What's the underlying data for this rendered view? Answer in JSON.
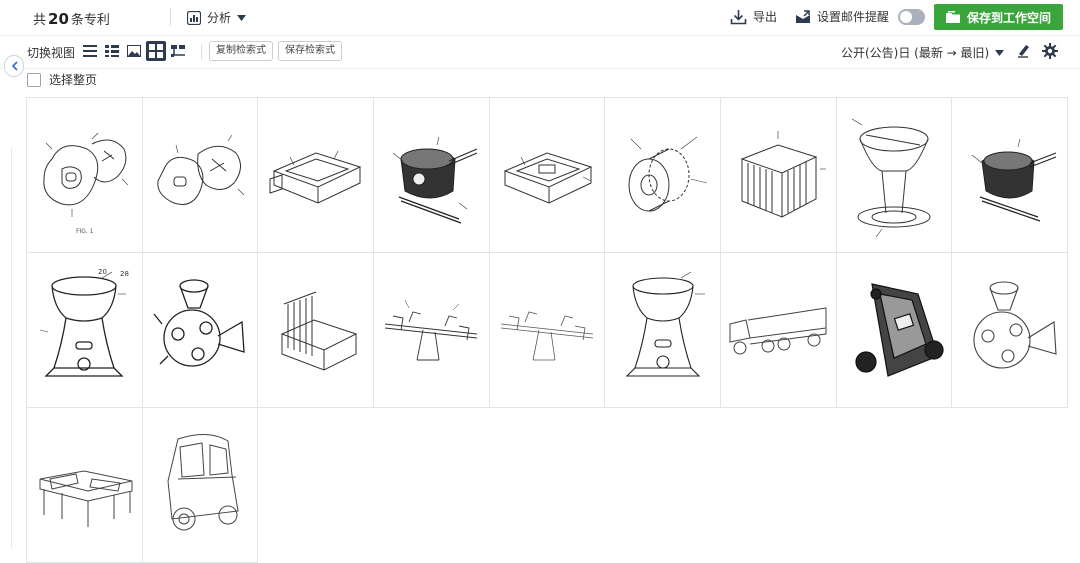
{
  "header": {
    "count_prefix": "共",
    "count_value": "20",
    "count_suffix": "条专利",
    "analyze_label": "分析",
    "export_label": "导出",
    "mail_label": "设置邮件提醒",
    "mail_toggle_on": false,
    "save_label": "保存到工作空间",
    "accent_color": "#3aa53a"
  },
  "toolbar": {
    "view_label": "切换视图",
    "view_modes": [
      "list-icon",
      "detail-list-icon",
      "image-icon",
      "grid-icon",
      "tree-icon"
    ],
    "active_view": "grid-icon",
    "copy_query_label": "复制检索式",
    "save_query_label": "保存检索式",
    "sort_label": "公开(公告)日 (最新 → 最旧)"
  },
  "selection": {
    "select_page_label": "选择整页"
  },
  "results": {
    "total_shown": 20,
    "fig_caption": "FIG. 1",
    "drawings": [
      "play-yard-drawing",
      "play-yard-drawing",
      "sandbox-tray-drawing",
      "machine-drawing",
      "sandbox-tray-drawing",
      "wheel-drawing",
      "crib-cage-drawing",
      "funnel-stand-drawing",
      "machine-drawing",
      "ball-tower-drawing",
      "ball-popper-drawing",
      "crib-cage-drawing",
      "seesaw-drawing",
      "seesaw-drawing",
      "ball-tower-drawing",
      "truck-drawing",
      "walker-drawing",
      "ball-popper-drawing",
      "water-table-drawing",
      "ride-on-car-drawing"
    ]
  }
}
